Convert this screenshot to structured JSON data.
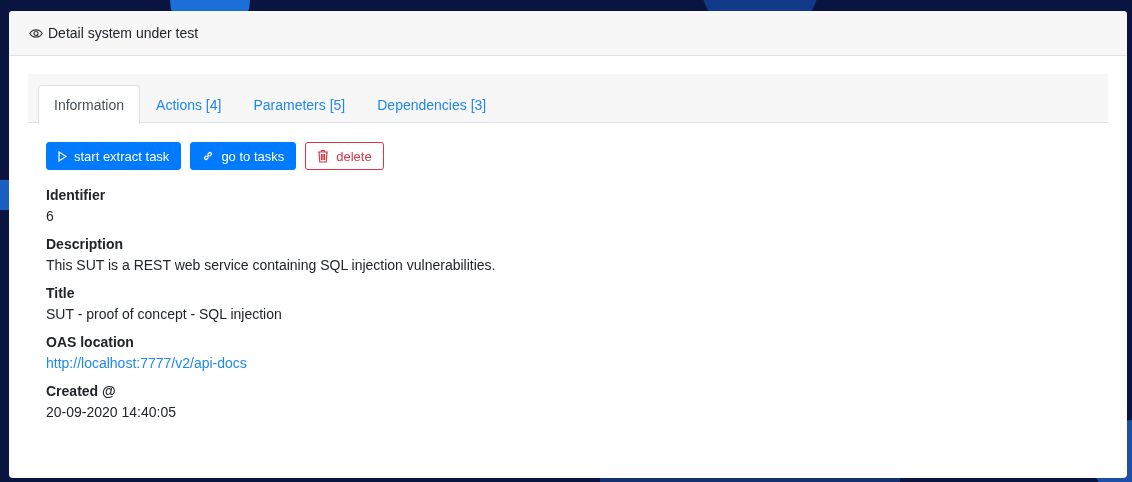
{
  "card": {
    "title": "Detail system under test"
  },
  "tabs": [
    {
      "label": "Information",
      "selected": true
    },
    {
      "label": "Actions [4]",
      "selected": false
    },
    {
      "label": "Parameters [5]",
      "selected": false
    },
    {
      "label": "Dependencies [3]",
      "selected": false
    }
  ],
  "buttons": [
    {
      "label": "start extract task",
      "kind": "start"
    },
    {
      "label": "go to tasks",
      "kind": "link"
    },
    {
      "label": "delete",
      "kind": "danger"
    }
  ],
  "fields": [
    {
      "label": "Identifier",
      "value": "6",
      "kind": "text"
    },
    {
      "label": "Description",
      "value": "This SUT is a REST web service containing SQL injection vulnerabilities.",
      "kind": "text"
    },
    {
      "label": "Title",
      "value": "SUT - proof of concept - SQL injection",
      "kind": "text"
    },
    {
      "label": "OAS location",
      "value": "http://localhost:7777/v2/api-docs",
      "kind": "link"
    },
    {
      "label": "Created @",
      "value": "20-09-2020 14:40:05",
      "kind": "text"
    }
  ]
}
